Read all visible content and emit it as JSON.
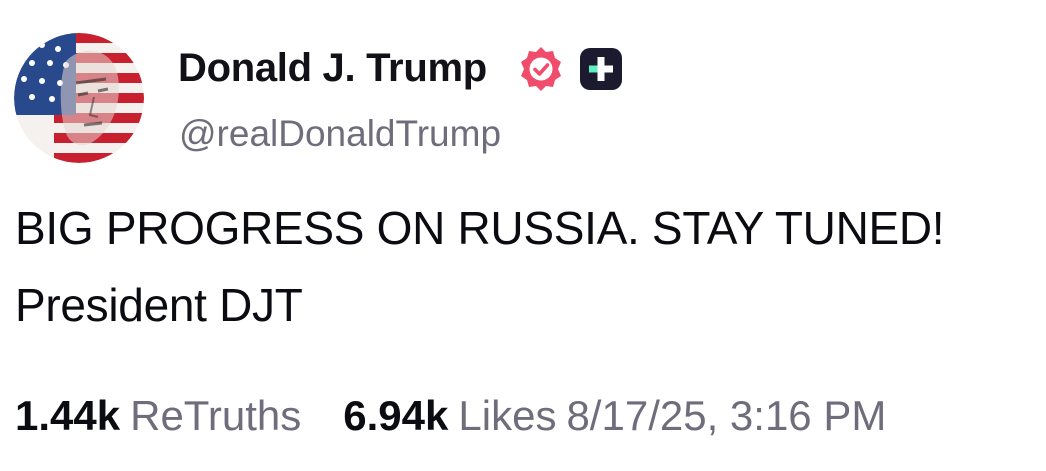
{
  "author": {
    "display_name": "Donald J. Trump",
    "handle": "@realDonaldTrump",
    "avatar_icon": "flag-portrait-avatar",
    "verified_icon": "verified-badge-icon",
    "plus_icon": "plus-badge-icon"
  },
  "post": {
    "text": "BIG PROGRESS ON RUSSIA. STAY TUNED! President DJT"
  },
  "stats": {
    "retruths_count": "1.44k",
    "retruths_label": "ReTruths",
    "likes_count": "6.94k",
    "likes_label": "Likes",
    "timestamp": "8/17/25, 3:16 PM"
  },
  "colors": {
    "text": "#0b0b12",
    "muted": "#6f6d7c",
    "verified": "#ef4d6b",
    "plus_badge": "#1b1a2e",
    "plus_accent": "#5ff0c2"
  }
}
